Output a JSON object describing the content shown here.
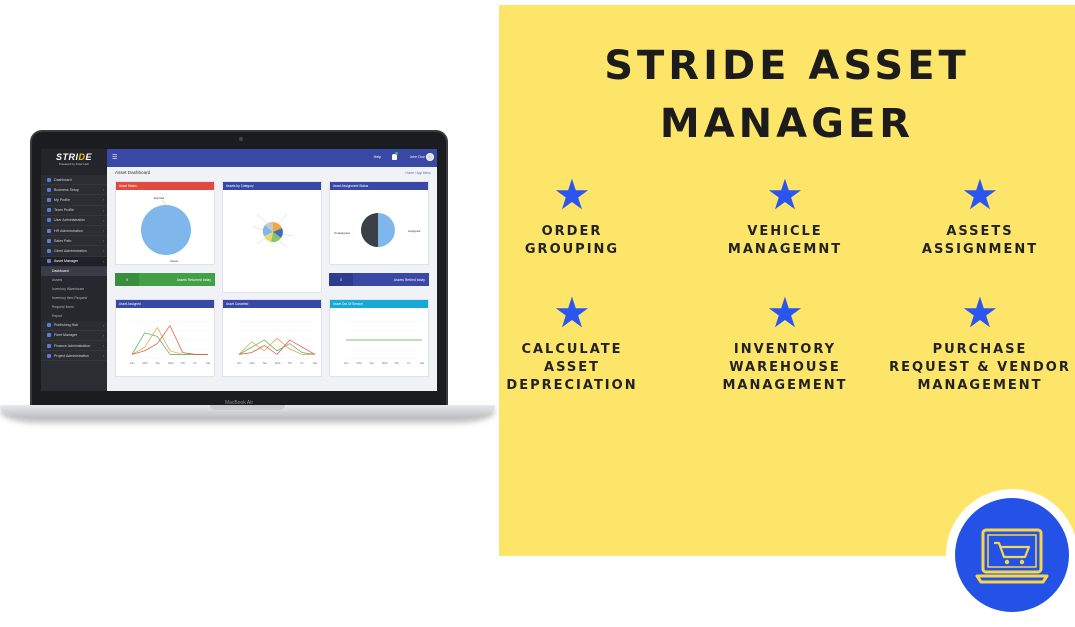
{
  "laptop": {
    "model_label": "MacBook Air",
    "app": {
      "logo": {
        "part1": "STRI",
        "part2": "D",
        "part3": "E",
        "suffix": "LITE",
        "powered_by": "Powered by Polar Hub"
      },
      "sidebar": {
        "items": [
          {
            "label": "Dashboard",
            "has_chevron": false
          },
          {
            "label": "Business Setup",
            "has_chevron": true
          },
          {
            "label": "My Profile",
            "has_chevron": true
          },
          {
            "label": "Team Profile",
            "has_chevron": true
          },
          {
            "label": "User Administration",
            "has_chevron": true
          },
          {
            "label": "HR Administration",
            "has_chevron": true
          },
          {
            "label": "Sales Path",
            "has_chevron": true
          },
          {
            "label": "Client Administration",
            "has_chevron": true
          },
          {
            "label": "Asset Manager",
            "has_chevron": true
          }
        ],
        "sub_items": [
          "Dashboard",
          "Assets",
          "Inventory Warehouse",
          "Inventory Item Request",
          "Request Items",
          "Report"
        ],
        "items_after": [
          {
            "label": "Publishing Hub",
            "has_chevron": true
          },
          {
            "label": "Fleet Manager",
            "has_chevron": true
          },
          {
            "label": "Finance Administration",
            "has_chevron": true
          },
          {
            "label": "Project Administration",
            "has_chevron": true
          }
        ]
      },
      "topbar": {
        "help": "Help",
        "user": "John Doe"
      },
      "page_title": "Asset Dashboard",
      "breadcrumb": "Home  /  App Menu",
      "cards": {
        "asset_status": {
          "title": "Asset Status",
          "labels": [
            "Expired",
            "Active"
          ]
        },
        "assets_by_category": {
          "title": "Assets by Category"
        },
        "assignment_status": {
          "title": "Asset Assignment Status",
          "labels": [
            "Unassigned",
            "Assigned"
          ]
        },
        "asset_assigned": {
          "title": "Asset Assigned"
        },
        "asset_canceled": {
          "title": "Asset Canceled"
        },
        "out_of_service": {
          "title": "Asset Out Of Service"
        }
      },
      "stats": [
        {
          "value": "0",
          "label": "Assets Returned today"
        },
        {
          "value": "0",
          "label": "Assets Retired today"
        }
      ],
      "days": [
        "Sun",
        "Mon",
        "Tue",
        "Wed",
        "Thu",
        "Fri",
        "Sat"
      ]
    }
  },
  "panel": {
    "title_line1": "STRIDE ASSET",
    "title_line2": "MANAGER",
    "features": [
      {
        "line1": "ORDER",
        "line2": "GROUPING",
        "line3": ""
      },
      {
        "line1": "VEHICLE",
        "line2": "MANAGEMNT",
        "line3": ""
      },
      {
        "line1": "ASSETS",
        "line2": "ASSIGNMENT",
        "line3": ""
      },
      {
        "line1": "CALCULATE",
        "line2": "ASSET",
        "line3": "DEPRECIATION"
      },
      {
        "line1": "INVENTORY",
        "line2": "WAREHOUSE",
        "line3": "MANAGEMENT"
      },
      {
        "line1": "PURCHASE",
        "line2": "REQUEST & VENDOR",
        "line3": "MANAGEMENT"
      }
    ],
    "star_color": "#2a56ef",
    "background_color": "#fde569"
  },
  "badge": {
    "icon": "laptop-cart-icon",
    "color": "#2452e6"
  }
}
